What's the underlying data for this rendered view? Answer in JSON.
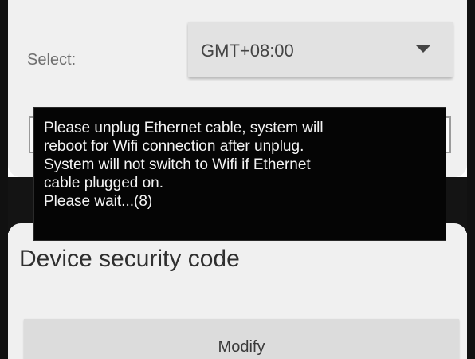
{
  "timezone": {
    "select_label": "Select:",
    "selected_value": "GMT+08:00"
  },
  "security": {
    "title": "Device security code",
    "modify_label": "Modify"
  },
  "toast": {
    "message": "Please unplug Ethernet cable, system will\nreboot for Wifi connection after unplug.\nSystem will not switch to Wifi if Ethernet\ncable plugged on.\nPlease wait...(8)"
  },
  "icons": {
    "dropdown": "chevron-down-icon"
  },
  "colors": {
    "card_background": "#f0f0f0",
    "toast_background": "#050505",
    "toast_text": "#f4f4f4",
    "dark_band": "#141414"
  }
}
